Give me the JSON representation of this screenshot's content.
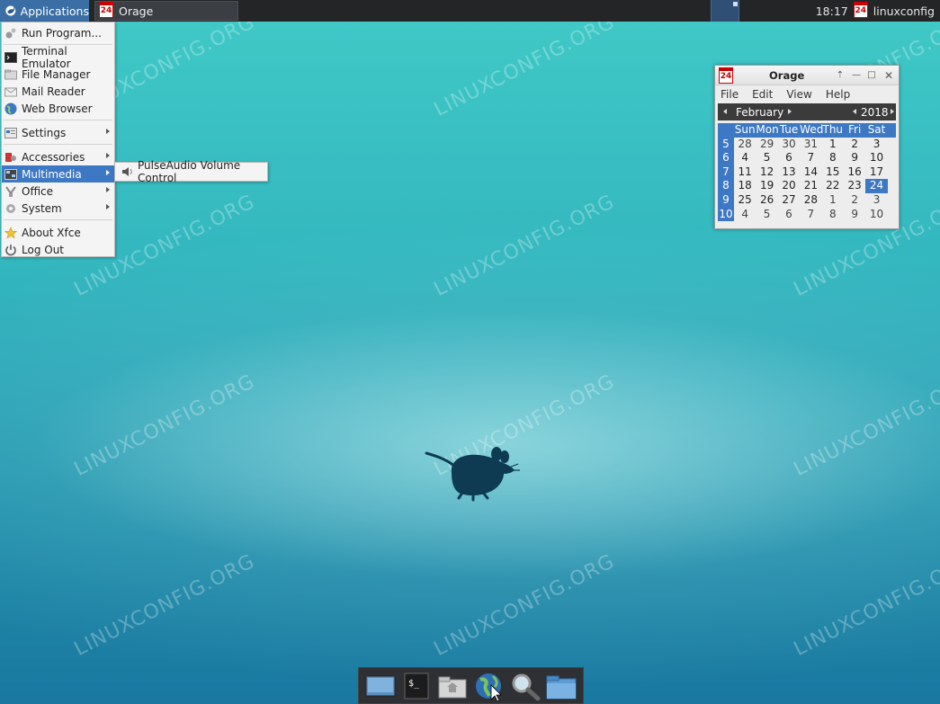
{
  "panel": {
    "apps_label": "Applications",
    "task_orage_label": "Orage",
    "task_orage_icon_day": "24",
    "clock": "18:17",
    "user": "linuxconfig",
    "tray_icon_day": "24"
  },
  "app_menu": {
    "items": [
      {
        "label": "Run Program...",
        "icon": "run-icon"
      },
      {
        "label": "Terminal Emulator",
        "icon": "terminal-icon"
      },
      {
        "label": "File Manager",
        "icon": "folder-icon"
      },
      {
        "label": "Mail Reader",
        "icon": "mail-icon"
      },
      {
        "label": "Web Browser",
        "icon": "globe-icon"
      },
      {
        "label": "Settings",
        "icon": "settings-icon"
      },
      {
        "label": "Accessories",
        "icon": "accessories-icon"
      },
      {
        "label": "Multimedia",
        "icon": "multimedia-icon"
      },
      {
        "label": "Office",
        "icon": "office-icon"
      },
      {
        "label": "System",
        "icon": "system-icon"
      },
      {
        "label": "About Xfce",
        "icon": "star-icon"
      },
      {
        "label": "Log Out",
        "icon": "power-icon"
      }
    ],
    "active": "Multimedia"
  },
  "submenu": {
    "items": [
      {
        "label": "PulseAudio Volume Control",
        "icon": "speaker-icon"
      }
    ]
  },
  "orage": {
    "title": "Orage",
    "title_icon_day": "24",
    "menubar": [
      "File",
      "Edit",
      "View",
      "Help"
    ],
    "month": "February",
    "year": "2018",
    "weekdays": [
      "Sun",
      "Mon",
      "Tue",
      "Wed",
      "Thu",
      "Fri",
      "Sat"
    ],
    "weeks": [
      {
        "num": "5",
        "days": [
          "28",
          "29",
          "30",
          "31",
          "1",
          "2",
          "3"
        ]
      },
      {
        "num": "6",
        "days": [
          "4",
          "5",
          "6",
          "7",
          "8",
          "9",
          "10"
        ]
      },
      {
        "num": "7",
        "days": [
          "11",
          "12",
          "13",
          "14",
          "15",
          "16",
          "17"
        ]
      },
      {
        "num": "8",
        "days": [
          "18",
          "19",
          "20",
          "21",
          "22",
          "23",
          "24"
        ]
      },
      {
        "num": "9",
        "days": [
          "25",
          "26",
          "27",
          "28",
          "1",
          "2",
          "3"
        ]
      },
      {
        "num": "10",
        "days": [
          "4",
          "5",
          "6",
          "7",
          "8",
          "9",
          "10"
        ]
      }
    ],
    "today": "24"
  },
  "watermark": "LINUXCONFIG.ORG",
  "colors": {
    "selection": "#3d78c4",
    "panel": "#232527",
    "desktop": "#2aa3b6"
  }
}
